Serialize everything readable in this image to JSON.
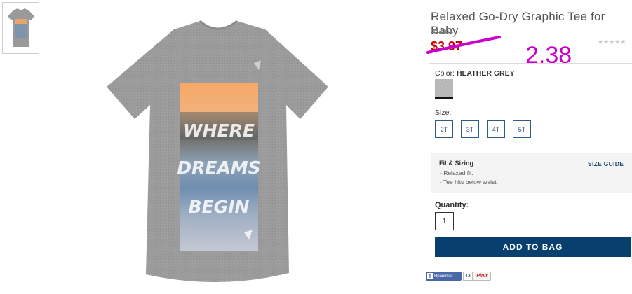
{
  "product": {
    "title": "Relaxed Go-Dry Graphic Tee for Baby",
    "old_price": "$14.94",
    "sale_price": "$3.97",
    "rating_stars": "★★★★★",
    "graphic_text": [
      "WHERE",
      "DREAMS",
      "BEGIN"
    ]
  },
  "annotation": {
    "value": "2.38",
    "color": "#cc00cc"
  },
  "color": {
    "label": "Color:",
    "value": "HEATHER GREY"
  },
  "size": {
    "label": "Size:",
    "options": [
      "2T",
      "3T",
      "4T",
      "5T"
    ]
  },
  "fit": {
    "title": "Fit & Sizing",
    "guide_link": "SIZE GUIDE",
    "items": [
      "- Relaxed fit.",
      "- Tee hits below waist."
    ]
  },
  "quantity": {
    "label": "Quantity:",
    "value": "1"
  },
  "cart": {
    "add_label": "ADD TO BAG",
    "color": "#073f6e"
  },
  "social": {
    "fb_label": "Нравится",
    "fb_count": "43",
    "pin_label": "Pinit"
  }
}
